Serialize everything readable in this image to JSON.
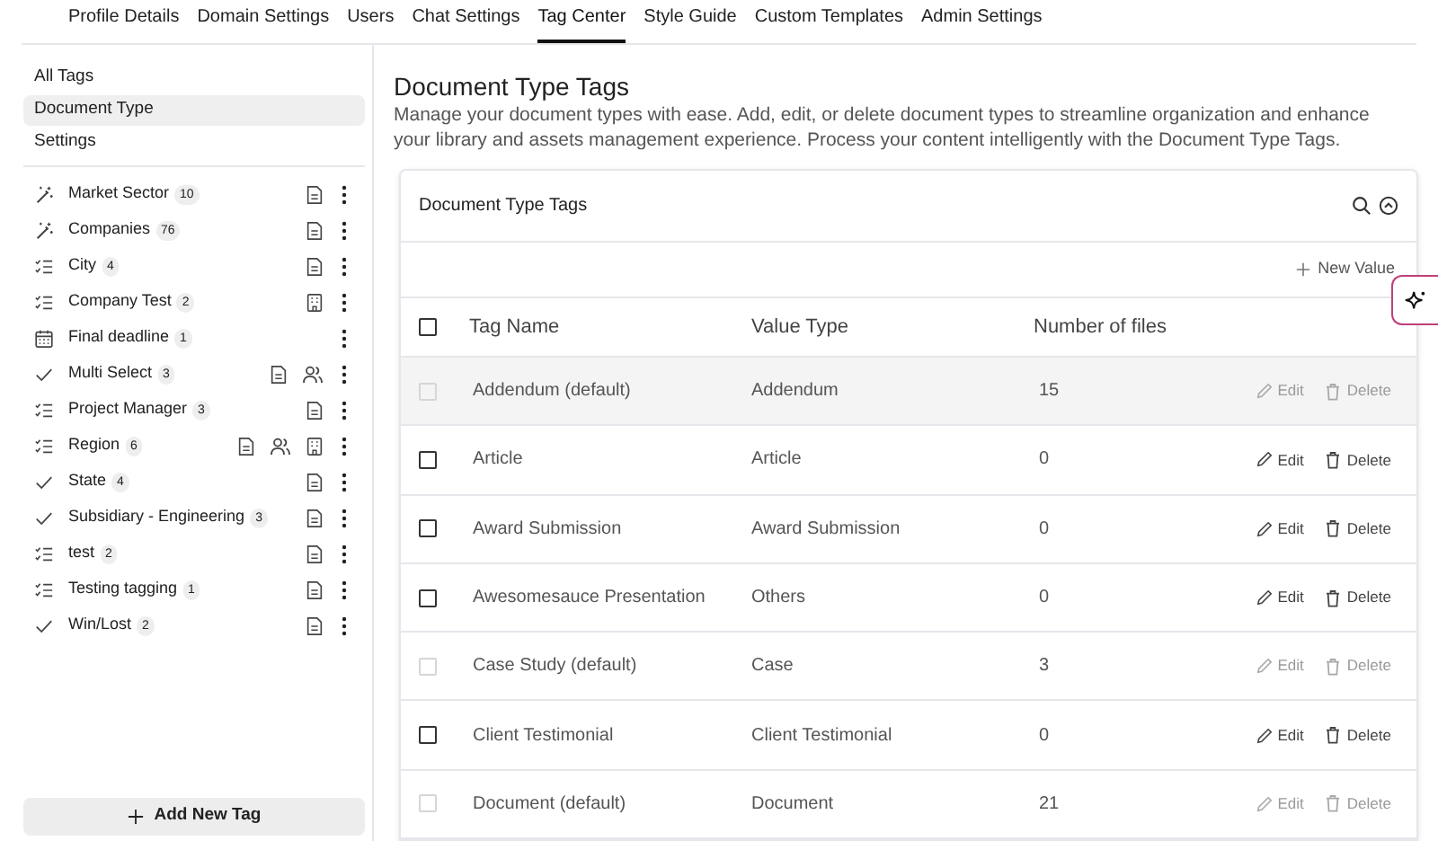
{
  "tabs": [
    {
      "label": "Profile Details",
      "selected": false
    },
    {
      "label": "Domain Settings",
      "selected": false
    },
    {
      "label": "Users",
      "selected": false
    },
    {
      "label": "Chat Settings",
      "selected": false
    },
    {
      "label": "Tag Center",
      "selected": true
    },
    {
      "label": "Style Guide",
      "selected": false
    },
    {
      "label": "Custom Templates",
      "selected": false
    },
    {
      "label": "Admin Settings",
      "selected": false
    }
  ],
  "sidebar": {
    "nav": [
      {
        "label": "All Tags",
        "selected": false
      },
      {
        "label": "Document Type",
        "selected": true
      },
      {
        "label": "Settings",
        "selected": false
      }
    ],
    "tags": [
      {
        "kind": "ai",
        "name": "Market Sector",
        "count": "10",
        "document": true,
        "people": false,
        "building": false
      },
      {
        "kind": "ai",
        "name": "Companies",
        "count": "76",
        "document": true,
        "people": false,
        "building": false
      },
      {
        "kind": "list",
        "name": "City",
        "count": "4",
        "document": true,
        "people": false,
        "building": false
      },
      {
        "kind": "list",
        "name": "Company Test",
        "count": "2",
        "document": false,
        "people": false,
        "building": true
      },
      {
        "kind": "date",
        "name": "Final deadline",
        "count": "1",
        "document": false,
        "people": false,
        "building": false
      },
      {
        "kind": "check",
        "name": "Multi Select",
        "count": "3",
        "document": true,
        "people": true,
        "building": false
      },
      {
        "kind": "list",
        "name": "Project Manager",
        "count": "3",
        "document": true,
        "people": false,
        "building": false
      },
      {
        "kind": "list",
        "name": "Region",
        "count": "6",
        "document": true,
        "people": true,
        "building": true
      },
      {
        "kind": "check",
        "name": "State",
        "count": "4",
        "document": true,
        "people": false,
        "building": false
      },
      {
        "kind": "check",
        "name": "Subsidiary - Engineering",
        "count": "3",
        "document": true,
        "people": false,
        "building": false
      },
      {
        "kind": "list",
        "name": "test",
        "count": "2",
        "document": true,
        "people": false,
        "building": false
      },
      {
        "kind": "list",
        "name": "Testing tagging",
        "count": "1",
        "document": true,
        "people": false,
        "building": false
      },
      {
        "kind": "check",
        "name": "Win/Lost",
        "count": "2",
        "document": true,
        "people": false,
        "building": false
      }
    ],
    "add_button": "Add New Tag"
  },
  "main": {
    "title": "Document Type Tags",
    "description": "Manage your document types with ease. Add, edit, or delete document types to streamline organization and enhance your library and assets management experience. Process your content intelligently with the Document Type Tags.",
    "card": {
      "title": "Document Type Tags",
      "new_value": "New Value",
      "select_all_checked": false,
      "columns": [
        "Tag Name",
        "Value Type",
        "Number of files"
      ],
      "rows": [
        {
          "name": "Addendum (default)",
          "type": "Addendum",
          "files": "15",
          "disabled": true,
          "edit": "Edit",
          "delete": "Delete"
        },
        {
          "name": "Article",
          "type": "Article",
          "files": "0",
          "disabled": false,
          "edit": "Edit",
          "delete": "Delete"
        },
        {
          "name": "Award Submission",
          "type": "Award Submission",
          "files": "0",
          "disabled": false,
          "edit": "Edit",
          "delete": "Delete"
        },
        {
          "name": "Awesomesauce Presentation",
          "type": "Others",
          "files": "0",
          "disabled": false,
          "edit": "Edit",
          "delete": "Delete"
        },
        {
          "name": "Case Study (default)",
          "type": "Case",
          "files": "3",
          "disabled": true,
          "edit": "Edit",
          "delete": "Delete"
        },
        {
          "name": "Client Testimonial",
          "type": "Client Testimonial",
          "files": "0",
          "disabled": false,
          "edit": "Edit",
          "delete": "Delete"
        },
        {
          "name": "Document (default)",
          "type": "Document",
          "files": "21",
          "disabled": true,
          "edit": "Edit",
          "delete": "Delete"
        }
      ]
    }
  }
}
